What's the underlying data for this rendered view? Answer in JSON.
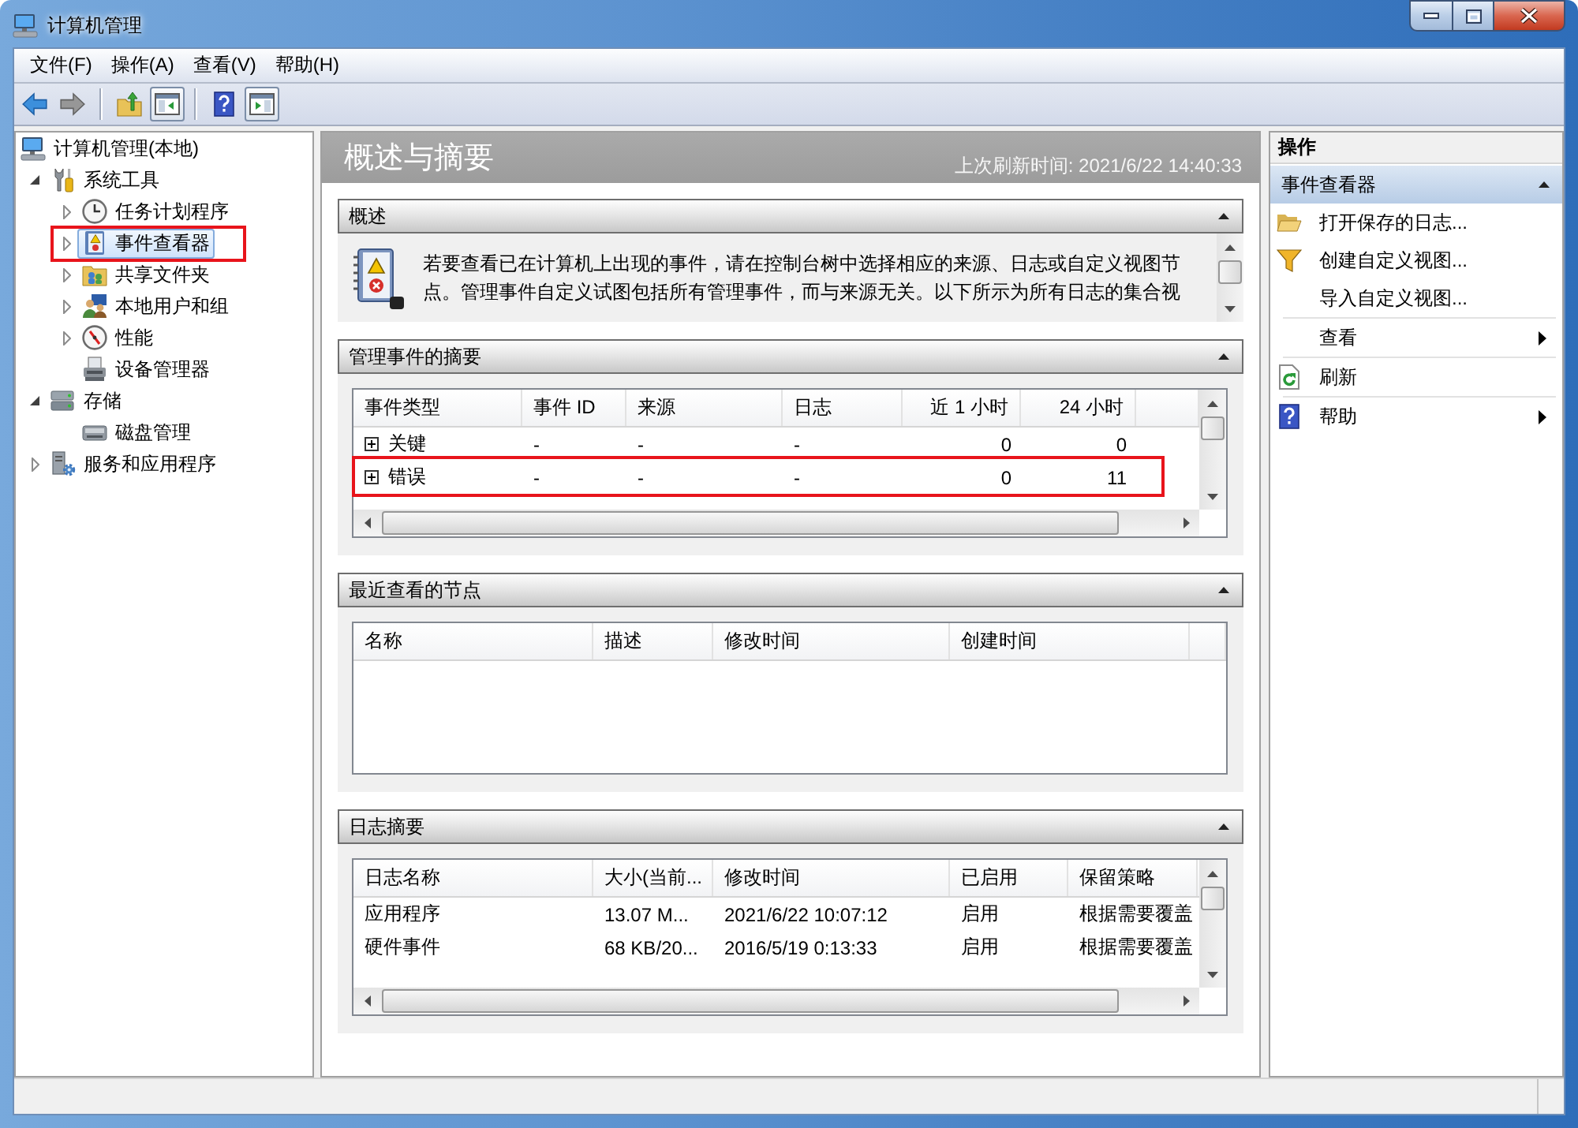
{
  "window": {
    "title": "计算机管理"
  },
  "menu": [
    {
      "label": "文件(F)"
    },
    {
      "label": "操作(A)"
    },
    {
      "label": "查看(V)"
    },
    {
      "label": "帮助(H)"
    }
  ],
  "toolbar": [
    [
      {
        "disabled": false,
        "pressed": false
      },
      {
        "disabled": true,
        "pressed": false
      }
    ],
    [
      {
        "disabled": false,
        "pressed": false
      },
      {
        "disabled": false,
        "pressed": true
      }
    ],
    [
      {
        "disabled": false,
        "pressed": false
      },
      {
        "disabled": false,
        "pressed": true
      }
    ]
  ],
  "tree": [
    {
      "label": "计算机管理(本地)",
      "selected": false,
      "highlighted": false,
      "children": [
        {
          "label": "系统工具",
          "expanded": true,
          "selected": false,
          "highlighted": false,
          "children": [
            {
              "label": "任务计划程序",
              "expanded": false,
              "selected": false,
              "highlighted": false
            },
            {
              "label": "事件查看器",
              "expanded": false,
              "selected": true,
              "highlighted": true
            },
            {
              "label": "共享文件夹",
              "expanded": false,
              "selected": false,
              "highlighted": false
            },
            {
              "label": "本地用户和组",
              "expanded": false,
              "selected": false,
              "highlighted": false
            },
            {
              "label": "性能",
              "expanded": false,
              "selected": false,
              "highlighted": false
            },
            {
              "label": "设备管理器",
              "selected": false,
              "highlighted": false
            }
          ]
        },
        {
          "label": "存储",
          "expanded": true,
          "selected": false,
          "highlighted": false,
          "children": [
            {
              "label": "磁盘管理",
              "selected": false,
              "highlighted": false
            }
          ]
        },
        {
          "label": "服务和应用程序",
          "expanded": false,
          "selected": false,
          "highlighted": false
        }
      ]
    }
  ],
  "overview_panel": {
    "title": "概述与摘要",
    "last_refresh": "上次刷新时间: 2021/6/22 14:40:33",
    "sections": [
      {
        "kind": "text",
        "title": "概述",
        "expanded": true,
        "text": "若要查看已在计算机上出现的事件，请在控制台树中选择相应的来源、日志或自定义视图节点。管理事件自定义试图包括所有管理事件，而与来源无关。以下所示为所有日志的集合视"
      },
      {
        "kind": "table",
        "title": "管理事件的摘要",
        "expanded": true,
        "columns": [
          {
            "label": "事件类型",
            "kind": "text"
          },
          {
            "label": "事件 ID",
            "kind": "text"
          },
          {
            "label": "来源",
            "kind": "text"
          },
          {
            "label": "日志",
            "kind": "text"
          },
          {
            "label": "近 1 小时",
            "kind": "number"
          },
          {
            "label": "24 小时",
            "kind": "number"
          }
        ],
        "rows": [
          {
            "cells": [
              "关键",
              "-",
              "-",
              "-",
              "0",
              "0"
            ],
            "expanded": false,
            "highlighted": false
          },
          {
            "cells": [
              "错误",
              "-",
              "-",
              "-",
              "0",
              "11"
            ],
            "expanded": false,
            "highlighted": true
          }
        ]
      },
      {
        "kind": "table",
        "title": "最近查看的节点",
        "expanded": true,
        "columns": [
          {
            "label": "名称",
            "kind": "text"
          },
          {
            "label": "描述",
            "kind": "text"
          },
          {
            "label": "修改时间",
            "kind": "text"
          },
          {
            "label": "创建时间",
            "kind": "text"
          }
        ]
      },
      {
        "kind": "table",
        "title": "日志摘要",
        "expanded": true,
        "columns": [
          {
            "label": "日志名称",
            "kind": "text"
          },
          {
            "label": "大小(当前...",
            "kind": "text"
          },
          {
            "label": "修改时间",
            "kind": "text"
          },
          {
            "label": "已启用",
            "kind": "text"
          },
          {
            "label": "保留策略",
            "kind": "text"
          }
        ],
        "rows": [
          {
            "cells": [
              "应用程序",
              "13.07 M...",
              "2021/6/22 10:07:12",
              "启用",
              "根据需要覆盖"
            ]
          },
          {
            "cells": [
              "硬件事件",
              "68 KB/20...",
              "2016/5/19 0:13:33",
              "启用",
              "根据需要覆盖"
            ]
          }
        ]
      }
    ]
  },
  "actions_pane": {
    "title": "操作",
    "section": {
      "title": "事件查看器",
      "expanded": true,
      "groups": [
        [
          {
            "label": "打开保存的日志...",
            "submenu": false
          },
          {
            "label": "创建自定义视图...",
            "submenu": false
          },
          {
            "label": "导入自定义视图...",
            "submenu": false
          }
        ],
        [
          {
            "label": "查看",
            "submenu": true
          }
        ],
        [
          {
            "label": "刷新",
            "submenu": false
          }
        ],
        [
          {
            "label": "帮助",
            "submenu": true
          }
        ]
      ]
    }
  }
}
